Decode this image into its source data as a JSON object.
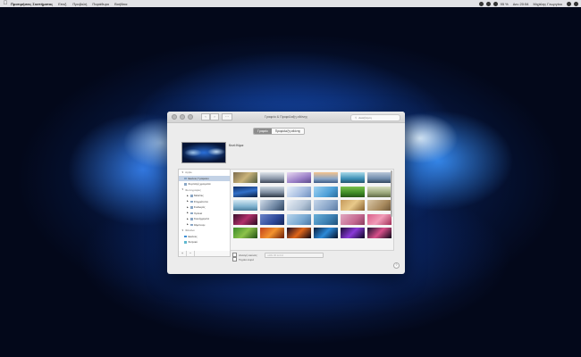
{
  "menubar": {
    "apple_icon": "apple-icon",
    "app_name": "Προτιμήσεις Συστήματος",
    "menus": [
      "Επεξ.",
      "Προβολή",
      "Παράθυρο",
      "Βοήθεια"
    ],
    "status_time": "Δευ 20:54",
    "status_user": "Μιχάλης Γεωργίου",
    "battery": "95 %"
  },
  "window": {
    "title": "Γραφείο & Προφύλαξη οθόνης",
    "search_placeholder": "Αναζήτηση",
    "nav_back": "‹",
    "nav_forward": "›",
    "grid_button": "⋯"
  },
  "tabs": [
    {
      "label": "Γραφείο",
      "active": true
    },
    {
      "label": "Προφύλαξη οθόνης",
      "active": false
    }
  ],
  "preview": {
    "label": "Κενό Κύμα"
  },
  "sidebar": [
    {
      "type": "section",
      "label": "Apple"
    },
    {
      "type": "item",
      "label": "Εικόνες Γραφείου",
      "selected": true
    },
    {
      "type": "item",
      "label": "Συμπαγή χρώματα",
      "selected": false
    },
    {
      "type": "section",
      "label": "Φωτογραφίες"
    },
    {
      "type": "child",
      "label": "Μελέτες",
      "selected": false
    },
    {
      "type": "child",
      "label": "Στιγμιότυπα",
      "selected": false
    },
    {
      "type": "child",
      "label": "Συλλογές",
      "selected": false
    },
    {
      "type": "child",
      "label": "Χρόνια",
      "selected": false
    },
    {
      "type": "child",
      "label": "Κοινόχρηστα",
      "selected": false
    },
    {
      "type": "child",
      "label": "Άλμπουμ",
      "selected": false
    },
    {
      "type": "section",
      "label": "Φάκελοι"
    },
    {
      "type": "item",
      "label": "Εικόνες",
      "selected": false
    },
    {
      "type": "item",
      "label": "Σκηνικό",
      "selected": false
    }
  ],
  "addbar": {
    "add": "+",
    "remove": "−"
  },
  "thumbnails": 30,
  "options": {
    "change_picture_label": "Αλλαγή εικόνας:",
    "interval_value": "κάθε 30 λεπτά",
    "random_order_label": "Τυχαία σειρά"
  },
  "help_label": "?"
}
